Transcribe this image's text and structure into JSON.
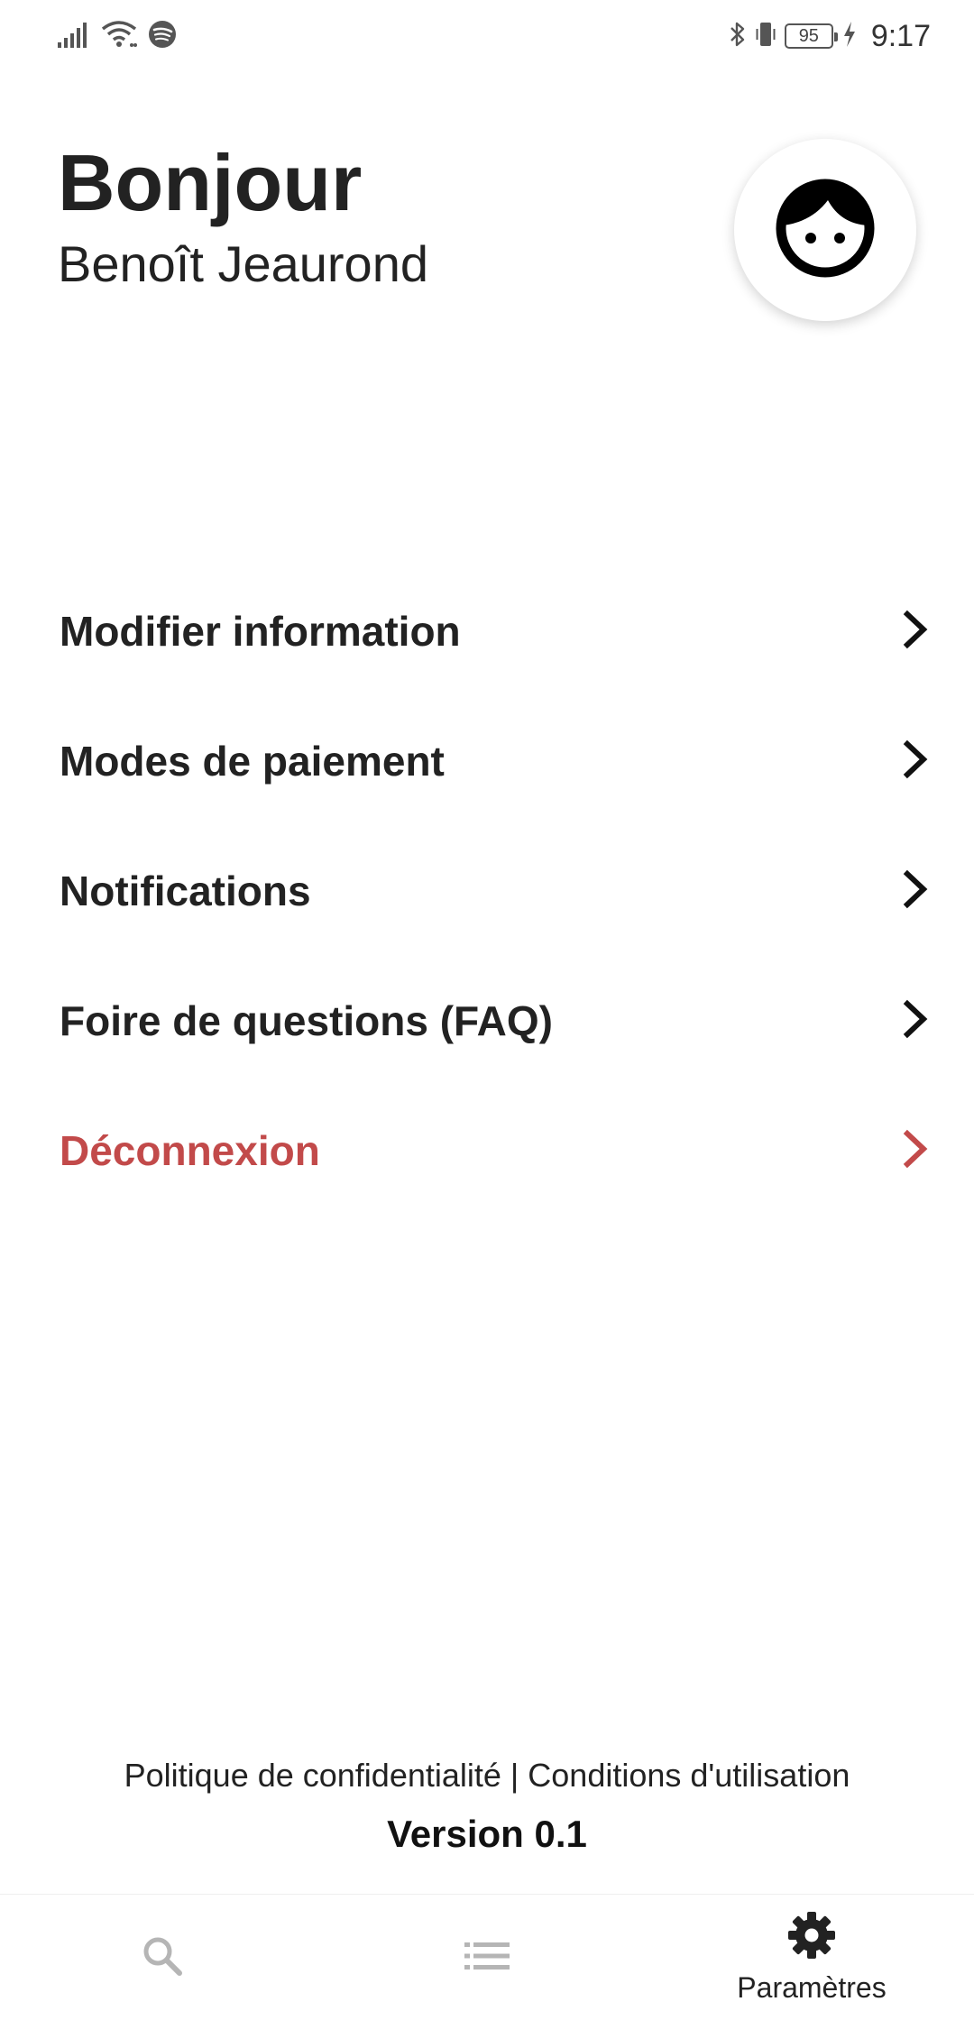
{
  "status_bar": {
    "battery_level": "95",
    "time": "9:17",
    "icons": [
      "signal-icon",
      "wifi-icon",
      "spotify-icon",
      "bluetooth-icon",
      "vibrate-icon",
      "battery-icon",
      "charging-icon"
    ]
  },
  "header": {
    "greeting": "Bonjour",
    "user_name": "Benoît Jeaurond",
    "avatar_icon": "face-icon"
  },
  "menu": {
    "items": [
      {
        "label": "Modifier information",
        "icon": "chevron-right-icon"
      },
      {
        "label": "Modes de paiement",
        "icon": "chevron-right-icon"
      },
      {
        "label": "Notifications",
        "icon": "chevron-right-icon"
      },
      {
        "label": "Foire de questions (FAQ)",
        "icon": "chevron-right-icon"
      },
      {
        "label": "Déconnexion",
        "icon": "chevron-right-icon",
        "color": "#c24a4a"
      }
    ]
  },
  "footer": {
    "privacy_label": "Politique de confidentialité",
    "separator": " | ",
    "terms_label": "Conditions d'utilisation",
    "version": "Version 0.1"
  },
  "bottom_nav": {
    "items": [
      {
        "icon": "search-icon",
        "label": "",
        "active": false
      },
      {
        "icon": "list-icon",
        "label": "",
        "active": false
      },
      {
        "icon": "gear-icon",
        "label": "Paramètres",
        "active": true
      }
    ]
  },
  "colors": {
    "danger": "#c24a4a",
    "text": "#222222",
    "inactive_icon": "#b5b5b5"
  }
}
